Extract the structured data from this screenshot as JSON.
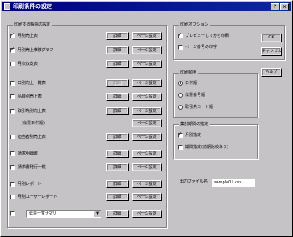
{
  "window": {
    "title": "印刷条件の設定",
    "help_btn": "?",
    "close_btn": "×"
  },
  "left_group": {
    "label": "印刷する帳票の設定",
    "items": [
      {
        "label": "月別売上表",
        "checked": true,
        "btn1": "詳細",
        "btn2": "ページ設定",
        "btn1_disabled": false
      },
      {
        "label": "月別売上推移グラフ",
        "checked": true,
        "btn1": "詳細",
        "btn2": "ページ設定",
        "btn1_disabled": false
      },
      {
        "label": "月次収支表",
        "checked": false,
        "btn1": "詳細",
        "btn2": "ページ設定",
        "btn1_disabled": false
      },
      {
        "label": "日別売上一覧表",
        "checked": false,
        "btn1": "詳細",
        "btn2": "ページ設定",
        "btn1_disabled": true
      },
      {
        "label": "品目別売上表",
        "checked": false,
        "btn1": "詳細",
        "btn2": "ページ設定",
        "btn1_disabled": false
      },
      {
        "label": "取引先別売上表",
        "checked": false,
        "btn1": "詳細",
        "btn2": "ページ設定",
        "btn1_disabled": false
      },
      {
        "label": "(伝票日付順)",
        "checked": null,
        "btn1": "",
        "btn2": "ページ設定",
        "btn1_disabled": false
      },
      {
        "label": "担当者別売上表",
        "checked": false,
        "btn1": "詳細",
        "btn2": "ページ設定",
        "btn1_disabled": false
      },
      {
        "label": "請求明細書",
        "checked": false,
        "btn1": "詳細",
        "btn2": "ページ設定",
        "btn1_disabled": false
      },
      {
        "label": "請求書発行一覧",
        "checked": false,
        "btn1": "詳細",
        "btn2": "ページ設定",
        "btn1_disabled": false
      },
      {
        "label": "月別レポート",
        "checked": false,
        "btn1": "詳細",
        "btn2": "ページ設定",
        "btn1_disabled": false
      },
      {
        "label": "月別ユーザーレポート",
        "checked": false,
        "btn1": "詳細",
        "btn2": "ページ設定",
        "btn1_disabled": false
      }
    ],
    "custom_select": "伝票一覧サマリ",
    "custom_btn1": "詳細",
    "custom_btn2": "ページ設定"
  },
  "right_group": {
    "label": "印刷オプション",
    "opt1": "プレビューしてから印刷",
    "opt2": "ページ番号の印字",
    "ok": "OK",
    "cancel": "キャンセル",
    "help": "ヘルプ"
  },
  "sort_group": {
    "label": "印刷順序",
    "r1": "日付順",
    "r2": "伝票番号順",
    "r3": "取引先コード順"
  },
  "period_group": {
    "label": "集計期間の指定",
    "c1": "月別指定",
    "c2": "期間指定(前期比較あり)"
  },
  "output": {
    "label": "出力ファイル名",
    "value": "sample01.csv"
  }
}
